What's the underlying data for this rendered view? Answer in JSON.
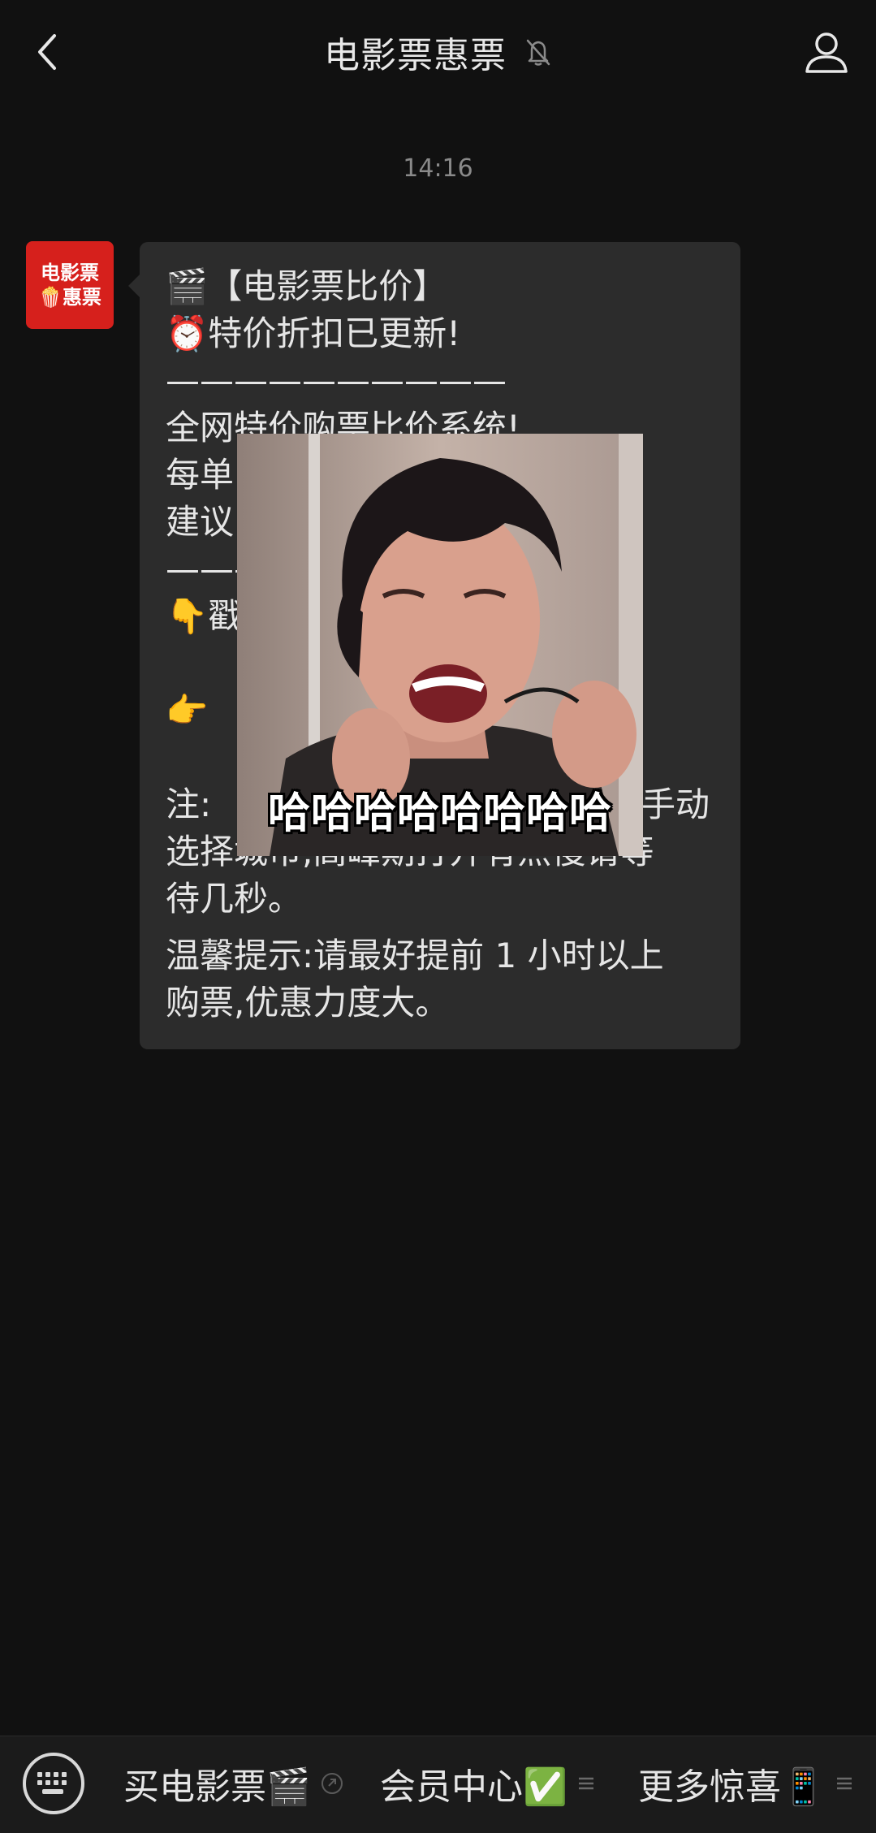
{
  "header": {
    "title": "电影票惠票",
    "back_icon": "chevron-left-icon",
    "mute_icon": "bell-off-icon",
    "profile_icon": "person-icon"
  },
  "timestamp": "14:16",
  "sender": {
    "avatar_line1": "电影票",
    "avatar_line2": "惠票",
    "avatar_color": "#d6201c"
  },
  "message": {
    "line1": "🎬【电影票比价】",
    "line2": "⏰特价折扣已更新!",
    "line3": "——————————",
    "line4": "全网特价购票比价系统!",
    "line5": "每单",
    "line6": "建议",
    "line7": "———",
    "line8": "👇戳",
    "line9": "👉",
    "line10": "注:",
    "line10_end": "手动",
    "line11": "选择城市,高峰期打开有点慢请等",
    "line12": "待几秒。",
    "line13": "温馨提示:请最好提前 1 小时以上",
    "line14": "购票,优惠力度大。"
  },
  "sticker": {
    "caption": "哈哈哈哈哈哈哈哈"
  },
  "menu": {
    "keyboard_icon": "keyboard-icon",
    "items": [
      {
        "label": "买电影票🎬",
        "sub_icon": "link-icon"
      },
      {
        "label": "会员中心✅",
        "sub_icon": "list-icon"
      },
      {
        "label": "更多惊喜📱",
        "sub_icon": "list-icon"
      }
    ]
  },
  "colors": {
    "background": "#111111",
    "bubble": "#2c2c2c",
    "accent_red": "#d6201c"
  }
}
